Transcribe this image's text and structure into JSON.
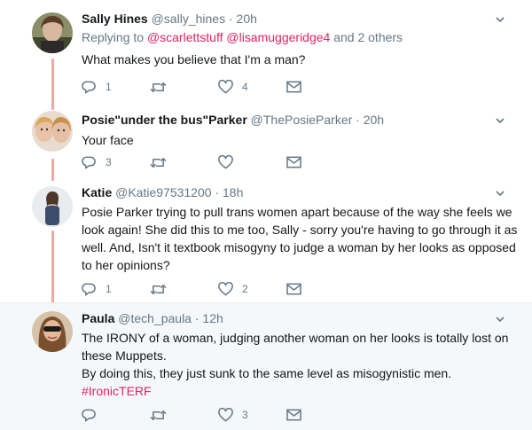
{
  "tweets": [
    {
      "name": "Sally Hines",
      "handle": "@sally_hines",
      "dot": "·",
      "time": "20h",
      "reply_prefix": "Replying to",
      "reply_user1": "@scarlettstuff",
      "reply_user2": "@lisamuggeridge4",
      "reply_suffix": "and 2 others",
      "text": [
        "What makes you believe that I'm a man?"
      ],
      "replies": "1",
      "retweets": "",
      "likes": "4"
    },
    {
      "name": "Posie\"under the bus\"Parker",
      "handle": "@ThePosieParker",
      "dot": "·",
      "time": "20h",
      "text": [
        "Your face"
      ],
      "replies": "3",
      "retweets": "",
      "likes": ""
    },
    {
      "name": "Katie",
      "handle": "@Katie97531200",
      "dot": "·",
      "time": "18h",
      "text": [
        "Posie Parker trying to pull trans women apart because of the way she feels we",
        "look again!  She did this to me too, Sally - sorry you're having to go through it as",
        "well. And, Isn't it textbook misogyny to judge a woman by her looks as opposed",
        "to her opinions?"
      ],
      "replies": "1",
      "retweets": "",
      "likes": "2"
    },
    {
      "name": "Paula",
      "handle": "@tech_paula",
      "dot": "·",
      "time": "12h",
      "text": [
        "The IRONY of a woman, judging another woman on her looks is totally lost on",
        "these Muppets.",
        "By doing this, they just sunk to the same level as misogynistic men."
      ],
      "hashtag": "#IronicTERF",
      "replies": "",
      "retweets": "",
      "likes": "3"
    }
  ],
  "colors": {
    "thread_line": "#f2a7a7",
    "link": "#e0245e",
    "muted": "#657786",
    "highlight_bg": "#f5f8fa"
  },
  "icons": [
    "reply-icon",
    "retweet-icon",
    "like-icon",
    "direct-message-icon",
    "chevron-down-icon"
  ]
}
